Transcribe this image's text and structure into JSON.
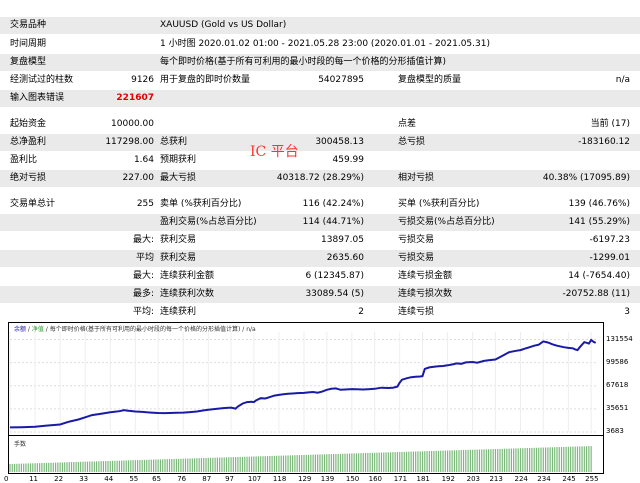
{
  "top": {
    "symbol_label": "交易品种",
    "symbol_value": "XAUUSD (Gold vs US Dollar)",
    "period_label": "时间周期",
    "period_value": "1 小时图 2020.01.02 01:00 - 2021.05.28 23:00 (2020.01.01 - 2021.05.31)",
    "model_label": "复盘模型",
    "model_value": "每个即时价格(基于所有可利用的最小时段的每一个价格的分形插值计算)",
    "bars_label": "经测试过的柱数",
    "bars_value": "9126",
    "ticks_label": "用于复盘的即时价数量",
    "ticks_value": "54027895",
    "quality_label": "复盘模型的质量",
    "quality_value": "n/a",
    "errors_label": "输入图表错误",
    "errors_value": "221607"
  },
  "stats": {
    "deposit_label": "起始资金",
    "deposit_value": "10000.00",
    "spread_label": "点差",
    "spread_value": "当前 (17)",
    "net_label": "总净盈利",
    "net_value": "117298.00",
    "gross_profit_label": "总获利",
    "gross_profit_value": "300458.13",
    "gross_loss_label": "总亏损",
    "gross_loss_value": "-183160.12",
    "pf_label": "盈利比",
    "pf_value": "1.64",
    "ep_label": "预期获利",
    "ep_value": "459.99",
    "abs_dd_label": "绝对亏损",
    "abs_dd_value": "227.00",
    "max_dd_label": "最大亏损",
    "max_dd_value": "40318.72 (28.29%)",
    "rel_dd_label": "相对亏损",
    "rel_dd_value": "40.38% (17095.89)",
    "trades_label": "交易单总计",
    "trades_value": "255",
    "short_label": "卖单 (%获利百分比)",
    "short_value": "116 (42.24%)",
    "long_label": "买单 (%获利百分比)",
    "long_value": "139 (46.76%)",
    "profit_trades_label": "盈利交易(%占总百分比)",
    "profit_trades_value": "114 (44.71%)",
    "loss_trades_label": "亏损交易(%占总百分比)",
    "loss_trades_value": "141 (55.29%)",
    "largest_label": "最大:",
    "largest_profit_label": "获利交易",
    "largest_profit_value": "13897.05",
    "largest_loss_label": "亏损交易",
    "largest_loss_value": "-6197.23",
    "average_label": "平均",
    "average_profit_label": "获利交易",
    "average_profit_value": "2635.60",
    "average_loss_label": "亏损交易",
    "average_loss_value": "-1299.01",
    "max_label": "最大:",
    "max_cons_wins_label": "连续获利金额",
    "max_cons_wins_value": "6 (12345.87)",
    "max_cons_losses_label": "连续亏损金额",
    "max_cons_losses_value": "14 (-7654.40)",
    "most_label": "最多:",
    "most_cons_profit_label": "连续获利次数",
    "most_cons_profit_value": "33089.54 (5)",
    "most_cons_loss_label": "连续亏损次数",
    "most_cons_loss_value": "-20752.88 (11)",
    "avg2_label": "平均:",
    "avg_cons_wins_label": "连续获利",
    "avg_cons_wins_value": "2",
    "avg_cons_losses_label": "连续亏损",
    "avg_cons_losses_value": "3"
  },
  "overlay_text": "IC 平台",
  "legend": {
    "balance": "余额",
    "sep1": " / ",
    "equity": "净值",
    "sep2": " / ",
    "desc": "每个即时价格(基于所有可利用的最小时段的每一个价格的分形插值计算) / n/a"
  },
  "volume_label": "手数",
  "colors": {
    "balance_line": "#1a1aa8",
    "equity_line": "#2a9a2a",
    "volume_bars": "#7ab87a",
    "error_text": "#e00000"
  },
  "chart_data": {
    "type": "line",
    "y_ticks": [
      3683,
      35651,
      67618,
      99586,
      131554
    ],
    "x_ticks": [
      0,
      11,
      22,
      33,
      44,
      55,
      65,
      76,
      87,
      97,
      107,
      118,
      129,
      139,
      150,
      160,
      171,
      181,
      192,
      203,
      213,
      224,
      234,
      245,
      255
    ],
    "ylim": [
      3683,
      142000
    ],
    "xlim": [
      0,
      258
    ],
    "series": [
      {
        "x": [
          0,
          5,
          11,
          16,
          22,
          26,
          30,
          33,
          36,
          40,
          44,
          48,
          50,
          52,
          55,
          58,
          60,
          62,
          65,
          68,
          70,
          73,
          76,
          79,
          82,
          85,
          87,
          90,
          93,
          95,
          97,
          99,
          100,
          102,
          104,
          106,
          107,
          108,
          110,
          112,
          114,
          116,
          118,
          120,
          122,
          124,
          126,
          129,
          131,
          133,
          135,
          137,
          139,
          141,
          143,
          145,
          147,
          150,
          152,
          155,
          158,
          160,
          163,
          166,
          168,
          170,
          171,
          172,
          174,
          176,
          178,
          180,
          181,
          182,
          184,
          186,
          188,
          190,
          192,
          194,
          196,
          198,
          200,
          203,
          205,
          208,
          210,
          213,
          216,
          219,
          222,
          224,
          226,
          228,
          230,
          232,
          234,
          236,
          238,
          240,
          243,
          245,
          247,
          248,
          249,
          250,
          252,
          254,
          255,
          256,
          257
        ],
        "y": [
          10000,
          10300,
          11000,
          12500,
          14000,
          18000,
          21000,
          24000,
          27000,
          29000,
          31000,
          32500,
          34000,
          33000,
          32000,
          31500,
          31000,
          30500,
          30000,
          29800,
          30000,
          30300,
          30500,
          31200,
          32000,
          33500,
          34500,
          35500,
          36500,
          37000,
          37500,
          36000,
          39000,
          43000,
          45000,
          45500,
          45000,
          47500,
          50500,
          50000,
          52000,
          54000,
          55000,
          56000,
          56500,
          57000,
          57500,
          57800,
          58500,
          59000,
          58000,
          59500,
          62000,
          63500,
          64000,
          62000,
          62500,
          63000,
          62800,
          62500,
          63000,
          63500,
          65000,
          64500,
          65000,
          66500,
          72000,
          76000,
          78000,
          79500,
          80000,
          80500,
          81000,
          91000,
          93000,
          94000,
          94500,
          95000,
          96000,
          97000,
          98500,
          98000,
          100000,
          100500,
          99500,
          102000,
          103000,
          104000,
          109000,
          114000,
          116000,
          117000,
          119000,
          121000,
          123000,
          124500,
          129000,
          127500,
          125000,
          123000,
          121000,
          120000,
          119500,
          118000,
          117000,
          121000,
          128000,
          126000,
          131000,
          128500,
          127000
        ]
      }
    ]
  }
}
